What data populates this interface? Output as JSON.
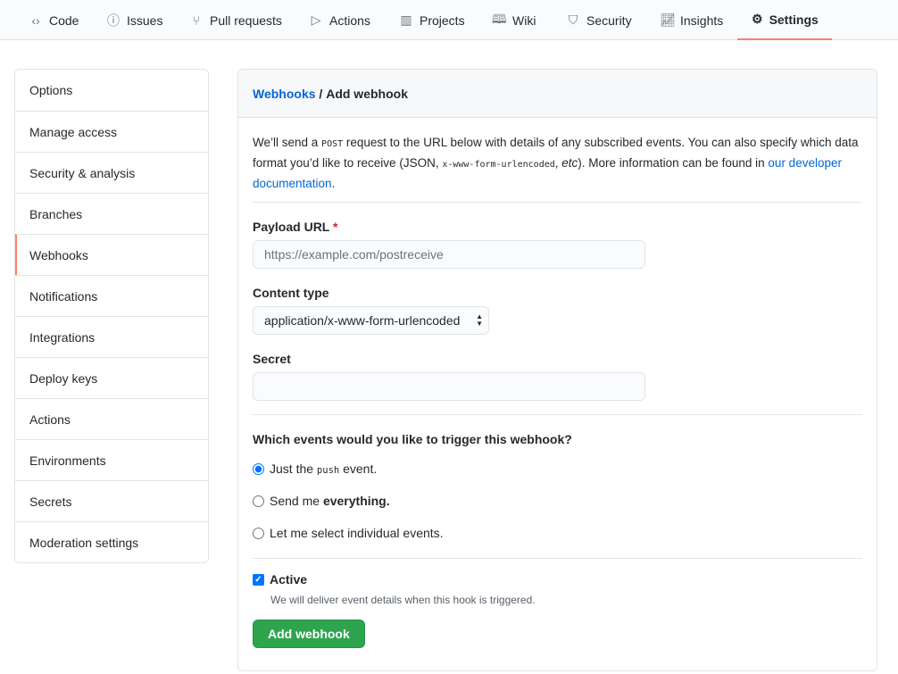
{
  "nav": {
    "tabs": [
      {
        "label": "Code",
        "icon": "code-icon"
      },
      {
        "label": "Issues",
        "icon": "issue-icon"
      },
      {
        "label": "Pull requests",
        "icon": "pull-request-icon"
      },
      {
        "label": "Actions",
        "icon": "play-icon"
      },
      {
        "label": "Projects",
        "icon": "project-icon"
      },
      {
        "label": "Wiki",
        "icon": "book-icon"
      },
      {
        "label": "Security",
        "icon": "shield-icon"
      },
      {
        "label": "Insights",
        "icon": "graph-icon"
      },
      {
        "label": "Settings",
        "icon": "gear-icon",
        "selected": true
      }
    ],
    "accent": "#f9826c"
  },
  "sidebar": {
    "items": [
      "Options",
      "Manage access",
      "Security & analysis",
      "Branches",
      "Webhooks",
      "Notifications",
      "Integrations",
      "Deploy keys",
      "Actions",
      "Environments",
      "Secrets",
      "Moderation settings"
    ],
    "selected": "Webhooks"
  },
  "main": {
    "breadcrumb_link": "Webhooks",
    "breadcrumb_sep": " / ",
    "breadcrumb_current": "Add webhook",
    "desc": {
      "p1": "We’ll send a ",
      "code1": "POST",
      "p2": " request to the URL below with details of any subscribed events. You can also specify which data format you’d like to receive (JSON, ",
      "code2": "x-www-form-urlencoded",
      "p3": ", ",
      "em": "etc",
      "p4": "). More information can be found in ",
      "link": "our developer documentation",
      "p5": "."
    },
    "payload_label": "Payload URL",
    "required_mark": "*",
    "payload_placeholder": "https://example.com/postreceive",
    "payload_value": "",
    "content_type_label": "Content type",
    "content_type_value": "application/x-www-form-urlencoded",
    "secret_label": "Secret",
    "secret_value": "",
    "events_question": "Which events would you like to trigger this webhook?",
    "radio_push_pre": "Just the ",
    "radio_push_code": "push",
    "radio_push_post": " event.",
    "radio_all_pre": "Send me ",
    "radio_all_bold": "everything.",
    "radio_select": "Let me select individual events.",
    "active_label": "Active",
    "active_checked": true,
    "active_note": "We will deliver event details when this hook is triggered.",
    "submit": "Add webhook",
    "submit_color": "#2ea44f",
    "link_color": "#0366d6"
  }
}
